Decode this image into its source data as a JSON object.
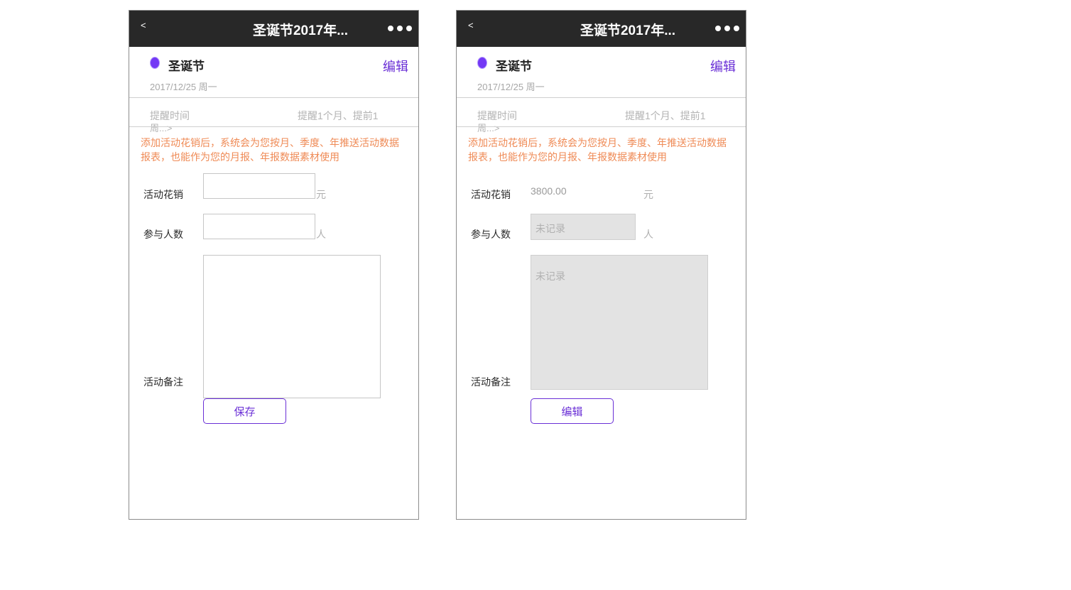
{
  "colors": {
    "accent": "#6a2fd6",
    "dot": "#7338f5",
    "notice": "#ef8a55",
    "navbar": "#282828"
  },
  "left": {
    "nav": {
      "back": "<",
      "title": "圣诞节2017年...",
      "more_icon": "more-dots-icon"
    },
    "event": {
      "name": "圣诞节",
      "edit": "编辑",
      "date": "2017/12/25 周一"
    },
    "reminder": {
      "label": "提醒时间",
      "value": "提醒1个月、提前1",
      "value_wrap": "周...>"
    },
    "notice": "添加活动花销后，系统会为您按月、季度、年推送活动数据报表，也能作为您的月报、年报数据素材使用",
    "form": {
      "spend_label": "活动花销",
      "spend_value": "",
      "spend_unit": "元",
      "people_label": "参与人数",
      "people_value": "",
      "people_unit": "人",
      "notes_label": "活动备注",
      "notes_value": ""
    },
    "button": "保存"
  },
  "right": {
    "nav": {
      "back": "<",
      "title": "圣诞节2017年...",
      "more_icon": "more-dots-icon"
    },
    "event": {
      "name": "圣诞节",
      "edit": "编辑",
      "date": "2017/12/25 周一"
    },
    "reminder": {
      "label": "提醒时间",
      "value": "提醒1个月、提前1",
      "value_wrap": "周...>"
    },
    "notice": "添加活动花销后，系统会为您按月、季度、年推送活动数据报表，也能作为您的月报、年报数据素材使用",
    "form": {
      "spend_label": "活动花销",
      "spend_value": "3800.00",
      "spend_unit": "元",
      "people_label": "参与人数",
      "people_placeholder": "未记录",
      "people_unit": "人",
      "notes_label": "活动备注",
      "notes_placeholder": "未记录"
    },
    "button": "编辑"
  }
}
